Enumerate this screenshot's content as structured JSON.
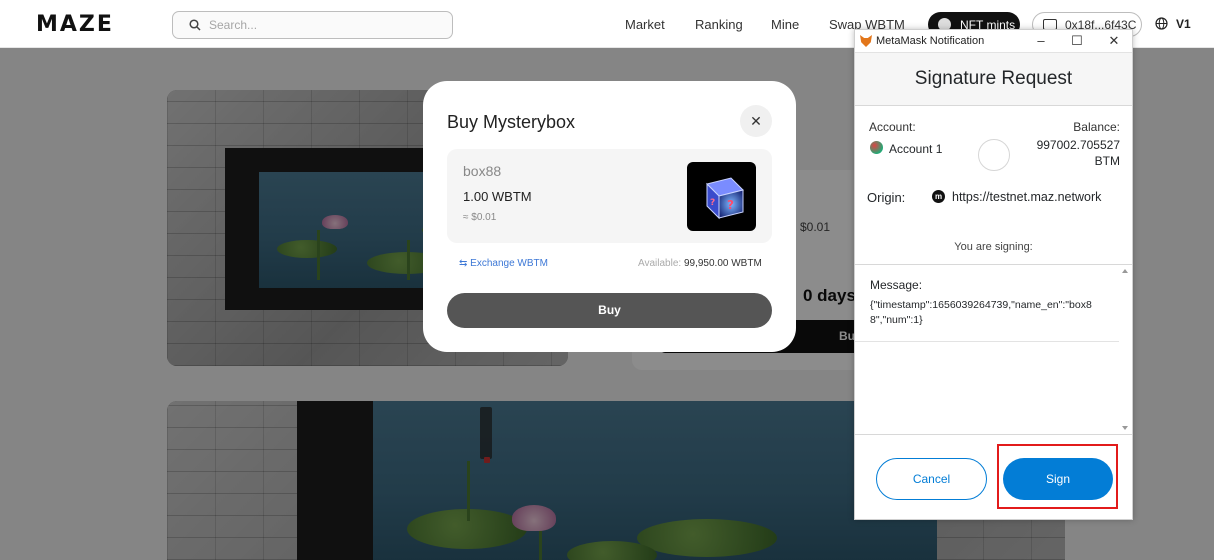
{
  "topnav": {
    "logo": "MAZE",
    "search_placeholder": "Search...",
    "links": [
      "Market",
      "Ranking",
      "Mine",
      "Swap WBTM"
    ],
    "nft_mints_label": "NFT mints",
    "wallet_address": "0x18f...6f43C",
    "version_label": "V1"
  },
  "background": {
    "price_usd": "$0.01",
    "countdown": "0 days",
    "buy_label": "Bu"
  },
  "modal": {
    "title": "Buy Mysterybox",
    "item_name": "box88",
    "item_price": "1.00 WBTM",
    "item_usd": "≈ $0.01",
    "exchange_label": "Exchange WBTM",
    "available_label": "Available:",
    "available_value": "99,950.00 WBTM",
    "buy_label": "Buy"
  },
  "metamask": {
    "window_title": "MetaMask Notification",
    "heading": "Signature Request",
    "account_label": "Account:",
    "account_name": "Account 1",
    "balance_label": "Balance:",
    "balance_value": "997002.705527",
    "balance_unit": "BTM",
    "origin_label": "Origin:",
    "origin_url": "https://testnet.maz.network",
    "signing_label": "You are signing:",
    "message_label": "Message:",
    "message_text": "{\"timestamp\":1656039264739,\"name_en\":\"box88\",\"num\":1}",
    "cancel_label": "Cancel",
    "sign_label": "Sign",
    "accent_color": "#037dd6",
    "highlight_color": "#e21b1b"
  }
}
